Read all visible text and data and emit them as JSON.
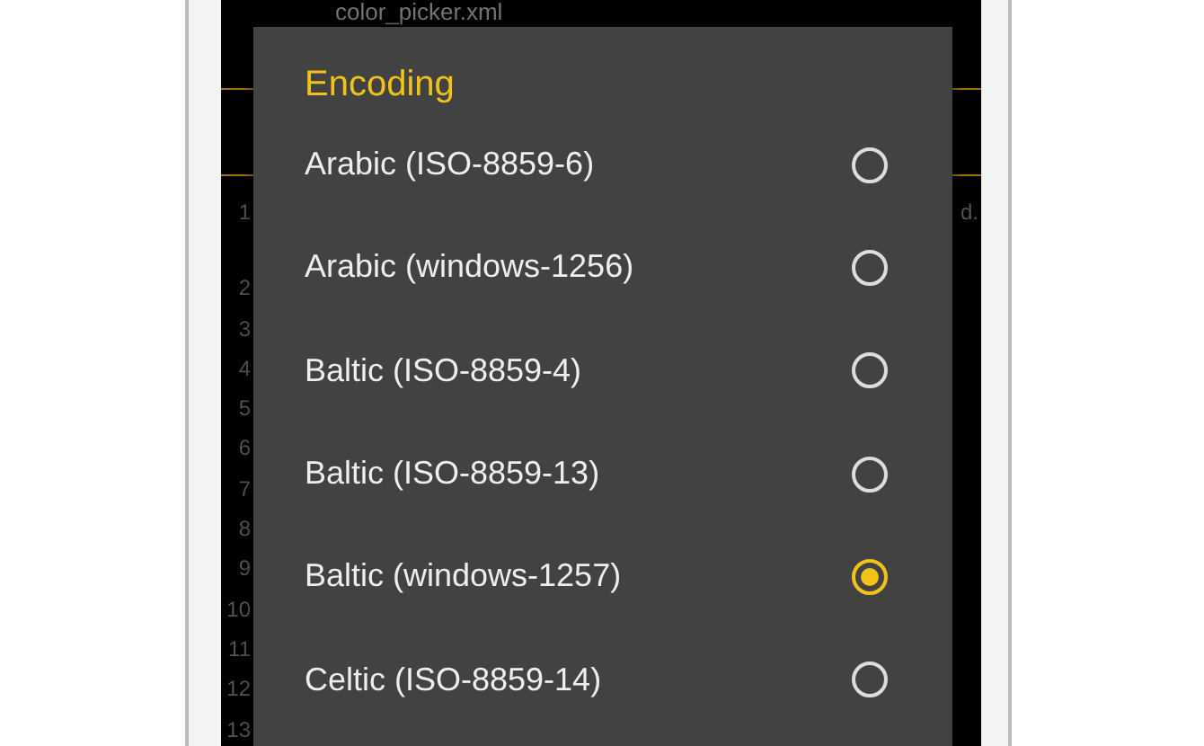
{
  "editor": {
    "file_name": "color_picker.xml",
    "line_numbers": [
      "1",
      "2",
      "3",
      "4",
      "5",
      "6",
      "7",
      "8",
      "9",
      "10",
      "11",
      "12",
      "13"
    ],
    "line_end_text": "d."
  },
  "dialog": {
    "title": "Encoding",
    "options": [
      {
        "label": "Arabic (ISO-8859-6)",
        "selected": false
      },
      {
        "label": "Arabic (windows-1256)",
        "selected": false
      },
      {
        "label": "Baltic (ISO-8859-4)",
        "selected": false
      },
      {
        "label": "Baltic (ISO-8859-13)",
        "selected": false
      },
      {
        "label": "Baltic (windows-1257)",
        "selected": true
      },
      {
        "label": "Celtic (ISO-8859-14)",
        "selected": false
      }
    ]
  }
}
